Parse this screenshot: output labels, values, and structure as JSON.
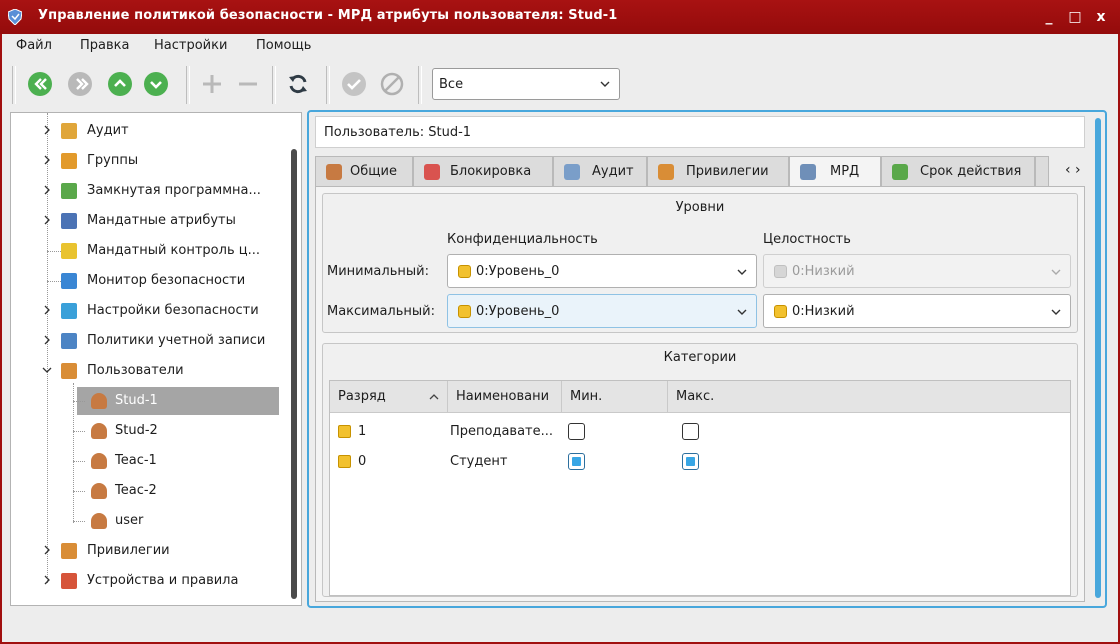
{
  "window": {
    "title": "Управление политикой безопасности - МРД атрибуты пользователя: Stud-1",
    "minimize": "_",
    "maximize": "□",
    "close": "x"
  },
  "menu": [
    "Файл",
    "Правка",
    "Настройки",
    "Помощь"
  ],
  "toolbar": {
    "icons": [
      "first-icon",
      "previous-icon",
      "up-icon",
      "down-icon",
      "add-icon",
      "remove-icon",
      "refresh-icon",
      "apply-icon",
      "cancel-icon"
    ],
    "filter_value": "Все"
  },
  "tree": {
    "items": [
      {
        "label": "Аудит",
        "icon": "audit-icon",
        "expandable": true
      },
      {
        "label": "Группы",
        "icon": "groups-icon",
        "expandable": true
      },
      {
        "label": "Замкнутая программна...",
        "icon": "closed-software-icon",
        "expandable": true
      },
      {
        "label": "Мандатные атрибуты",
        "icon": "mandatory-attributes-icon",
        "expandable": true
      },
      {
        "label": "Мандатный контроль ц...",
        "icon": "mandatory-control-icon",
        "expandable": false
      },
      {
        "label": "Монитор безопасности",
        "icon": "security-monitor-icon",
        "expandable": false
      },
      {
        "label": "Настройки безопасности",
        "icon": "security-settings-icon",
        "expandable": true
      },
      {
        "label": "Политики учетной записи",
        "icon": "account-policies-icon",
        "expandable": true
      },
      {
        "label": "Пользователи",
        "icon": "users-icon",
        "expandable": true,
        "expanded": true
      },
      {
        "label": "Stud-1",
        "icon": "user-icon",
        "child": true,
        "selected": true
      },
      {
        "label": "Stud-2",
        "icon": "user-icon",
        "child": true
      },
      {
        "label": "Teac-1",
        "icon": "user-icon",
        "child": true
      },
      {
        "label": "Teac-2",
        "icon": "user-icon",
        "child": true
      },
      {
        "label": "user",
        "icon": "user-icon",
        "child": true
      },
      {
        "label": "Привилегии",
        "icon": "privileges-icon",
        "expandable": true
      },
      {
        "label": "Устройства и правила",
        "icon": "devices-icon",
        "expandable": true
      }
    ]
  },
  "user_header": "Пользователь: Stud-1",
  "tabs": [
    {
      "label": "Общие",
      "icon": "general-tab-icon"
    },
    {
      "label": "Блокировка",
      "icon": "lock-tab-icon"
    },
    {
      "label": "Аудит",
      "icon": "audit-tab-icon"
    },
    {
      "label": "Привилегии",
      "icon": "privileges-tab-icon"
    },
    {
      "label": "МРД",
      "icon": "mrd-tab-icon",
      "active": true
    },
    {
      "label": "Срок действия",
      "icon": "expiry-tab-icon"
    }
  ],
  "levels": {
    "title": "Уровни",
    "col_conf": "Конфиденциальность",
    "col_integrity": "Целостность",
    "min_label": "Минимальный:",
    "max_label": "Максимальный:",
    "min_conf": "0:Уровень_0",
    "max_conf": "0:Уровень_0",
    "min_integrity": "0:Низкий",
    "max_integrity": "0:Низкий"
  },
  "categories": {
    "title": "Категории",
    "headers": [
      "Разряд",
      "Наименовани",
      "Мин.",
      "Макс."
    ],
    "sort_indicator": "^",
    "rows": [
      {
        "bit": "1",
        "name": "Преподавате...",
        "min": false,
        "max": false
      },
      {
        "bit": "0",
        "name": "Студент",
        "min": true,
        "max": true
      }
    ]
  },
  "colors": {
    "titlebar": "#a10f0f",
    "accent": "#48a7dc",
    "selection": "#a5a5a5",
    "toolbar_green": "#4cb050"
  }
}
